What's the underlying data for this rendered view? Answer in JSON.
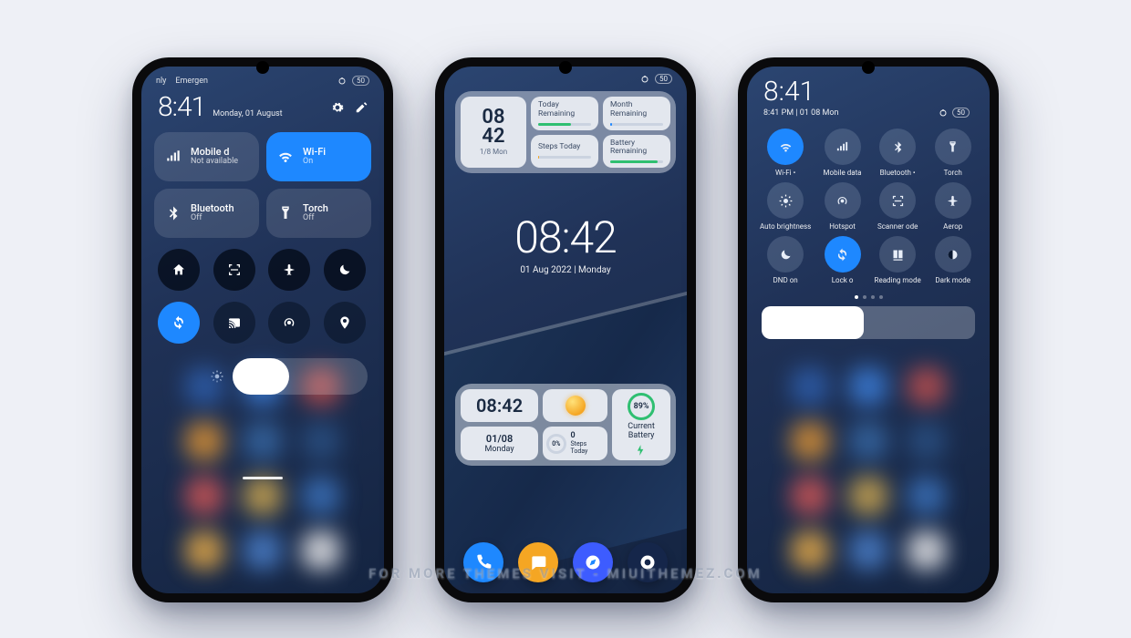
{
  "watermark": "FOR MORE THEMES VISIT - MIUITHEMEZ.COM",
  "phone1": {
    "status_left": [
      "nly",
      "Emergen"
    ],
    "status_battery": "50",
    "clock": "8:41",
    "date": "Monday, 01 August",
    "tiles": [
      {
        "label": "Mobile d",
        "sub": "Not available",
        "active": false,
        "icon": "bars"
      },
      {
        "label": "Wi-Fi",
        "sub": "On",
        "active": true,
        "icon": "wifi"
      },
      {
        "label": "Bluetooth",
        "sub": "Off",
        "active": false,
        "icon": "bluetooth"
      },
      {
        "label": "Torch",
        "sub": "Off",
        "active": false,
        "icon": "torch"
      }
    ],
    "small_row1_icons": [
      "home",
      "scan",
      "plane",
      "moon"
    ],
    "small_row2_icons": [
      "sync",
      "cast",
      "hotspot",
      "location"
    ]
  },
  "phone2": {
    "top_widget": {
      "hh": "08",
      "mm": "42",
      "date": "1/8 Mon",
      "cards": [
        {
          "caption": "Today Remaining",
          "color": "#2fbf71",
          "pct": 62
        },
        {
          "caption": "Month Remaining",
          "color": "#1e88ff",
          "pct": 3
        },
        {
          "caption": "Steps Today",
          "color": "#f5a623",
          "pct": 1
        },
        {
          "caption": "Battery Remaining",
          "color": "#2fbf71",
          "pct": 89
        }
      ]
    },
    "bigclock": {
      "time": "08:42",
      "date": "01 Aug 2022 | Monday"
    },
    "bottom_widget": {
      "time": "08:42",
      "date": "01/08",
      "day": "Monday",
      "steps_pct": "0%",
      "steps_val": "0",
      "steps_label": "Steps Today",
      "battery_pct": "89%",
      "battery_label": "Current Battery"
    },
    "dock_apps": [
      "phone",
      "message",
      "browser",
      "camera"
    ]
  },
  "phone3": {
    "clock": "8:41",
    "subtitle": "8:41 PM | 01 08 Mon",
    "battery": "50",
    "toggles": [
      {
        "label": "Wi-Fi •",
        "on": true,
        "icon": "wifi"
      },
      {
        "label": "Mobile data",
        "on": false,
        "icon": "bars"
      },
      {
        "label": "Bluetooth •",
        "on": false,
        "icon": "bluetooth"
      },
      {
        "label": "Torch",
        "on": false,
        "icon": "torch"
      },
      {
        "label": "Auto brightness",
        "on": false,
        "icon": "brightness"
      },
      {
        "label": "Hotspot",
        "on": false,
        "icon": "hotspot"
      },
      {
        "label": "Scanner    ode",
        "on": false,
        "icon": "scan"
      },
      {
        "label": "Aerop",
        "on": false,
        "icon": "plane"
      },
      {
        "label": "DND     on",
        "on": false,
        "icon": "moon"
      },
      {
        "label": "Lock o",
        "on": true,
        "icon": "sync"
      },
      {
        "label": "Reading mode",
        "on": false,
        "icon": "reading"
      },
      {
        "label": "Dark mode",
        "on": false,
        "icon": "dark"
      }
    ]
  }
}
